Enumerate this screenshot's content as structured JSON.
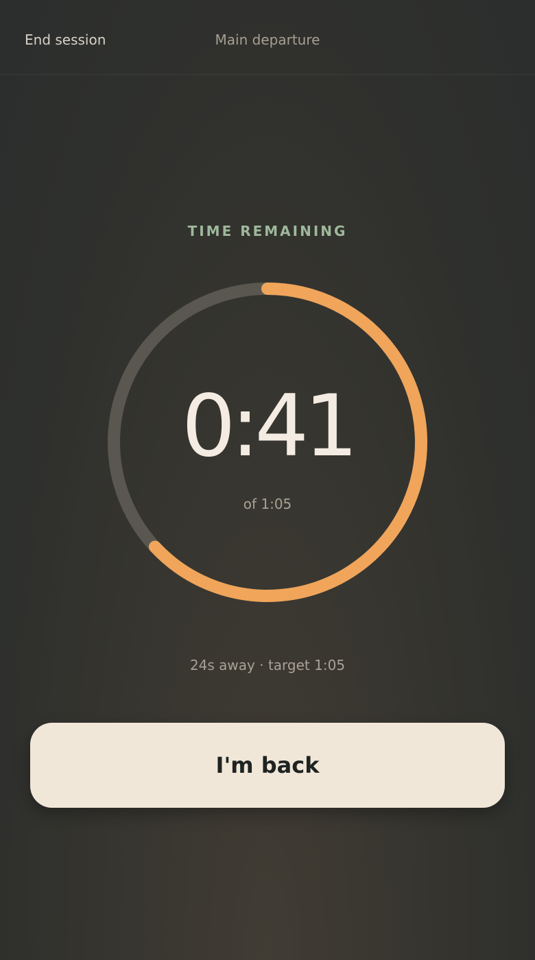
{
  "header": {
    "end_session_label": "End session",
    "title": "Main departure"
  },
  "timer": {
    "label": "TIME REMAINING",
    "remaining": "0:41",
    "remaining_seconds": 41,
    "total": "of 1:05",
    "total_seconds": 65,
    "progress_color": "#f0a55a",
    "track_color": "#5a5750"
  },
  "status": {
    "away_text": "24s away · target 1:05"
  },
  "actions": {
    "back_label": "I'm back"
  },
  "colors": {
    "accent_green": "#9eb89b",
    "button_bg": "#f1e7d9",
    "text_primary": "#f4ece2",
    "text_muted": "#aaa196"
  }
}
